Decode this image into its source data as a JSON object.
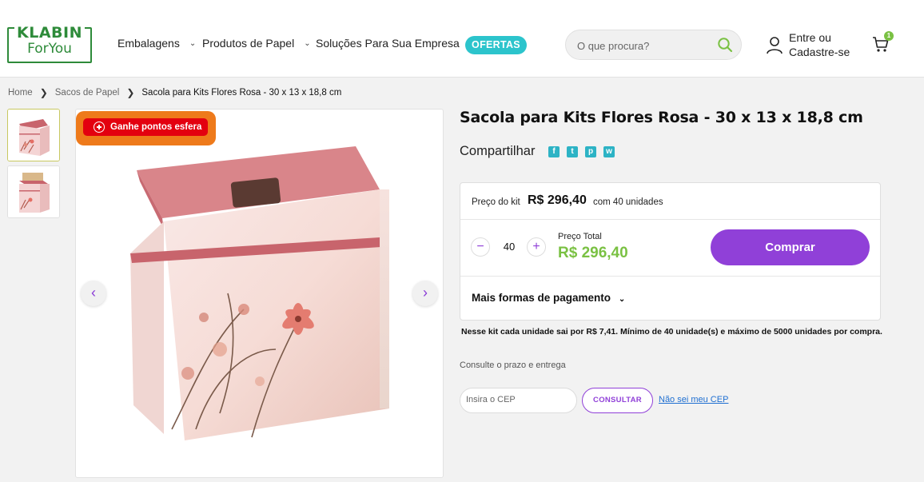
{
  "header": {
    "logo_top": "KLABIN",
    "logo_bottom": "ForYou",
    "nav": [
      {
        "label": "Embalagens"
      },
      {
        "label": "Produtos de Papel"
      },
      {
        "label": "Soluções Para Sua Empresa"
      }
    ],
    "ofertas": "OFERTAS",
    "search_placeholder": "O que procura?",
    "user_line1": "Entre ou",
    "user_line2": "Cadastre-se",
    "cart_count": "1"
  },
  "breadcrumb": [
    "Home",
    "Sacos de Papel",
    "Sacola para Kits Flores Rosa - 30 x 13 x 18,8 cm"
  ],
  "product": {
    "points_badge": "Ganhe pontos esfera",
    "title": "Sacola para Kits Flores Rosa - 30 x 13 x 18,8 cm",
    "share_label": "Compartilhar",
    "share_icons": [
      "facebook-icon",
      "twitter-icon",
      "pinterest-icon",
      "whatsapp-icon"
    ],
    "kit_label": "Preço do kit",
    "kit_price": "R$ 296,40",
    "kit_units": "com 40 unidades",
    "quantity": "40",
    "total_label": "Preço Total",
    "total_price": "R$ 296,40",
    "buy_label": "Comprar",
    "more_payment": "Mais formas de pagamento",
    "note": "Nesse kit cada unidade sai por R$ 7,41. Mínimo de 40 unidade(s) e máximo de 5000 unidades por compra.",
    "shipping_label": "Consulte o prazo e entrega",
    "cep_placeholder": "Insira o CEP",
    "consult_label": "CONSULTAR",
    "dont_know_cep": "Não sei meu CEP"
  },
  "colors": {
    "brand_green": "#2e8b3a",
    "accent_purple": "#9040d8",
    "price_green": "#7ac143",
    "teal": "#2cc4cc"
  }
}
